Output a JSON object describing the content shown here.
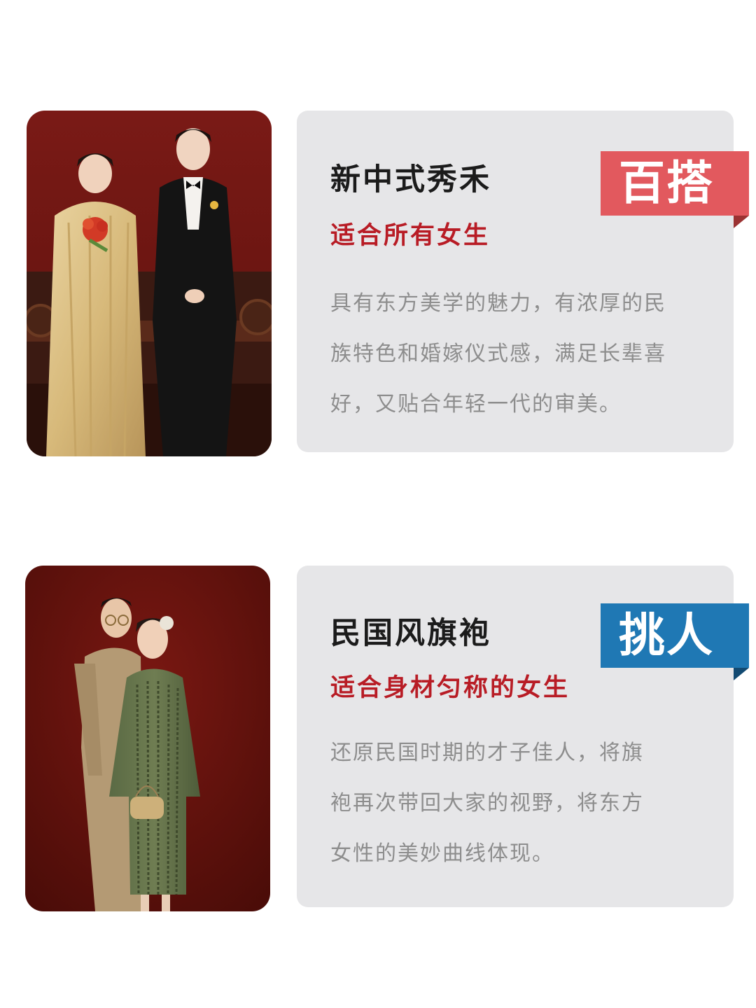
{
  "colors": {
    "card_background": "#e6e6e8",
    "subtitle_red": "#b81c25",
    "tag_red": "#e2595e",
    "tag_blue": "#1f78b4"
  },
  "cards": [
    {
      "title": "新中式秀禾",
      "subtitle": "适合所有女生",
      "tag": "百搭",
      "tag_color": "#e2595e",
      "tag_fold_color": "#9b3232",
      "description_lines": [
        "具有东方美学的魅力，有浓厚的民",
        "族特色和婚嫁仪式感，满足长辈喜",
        "好，又贴合年轻一代的审美。"
      ],
      "photo": "couple-in-xiuhe-and-tuxedo-photo"
    },
    {
      "title": "民国风旗袍",
      "subtitle": "适合身材匀称的女生",
      "tag": "挑人",
      "tag_color": "#1f78b4",
      "tag_fold_color": "#124a72",
      "description_lines": [
        "还原民国时期的才子佳人，将旗",
        "袍再次带回大家的视野，将东方",
        "女性的美妙曲线体现。"
      ],
      "photo": "couple-in-qipao-and-suit-photo"
    }
  ]
}
